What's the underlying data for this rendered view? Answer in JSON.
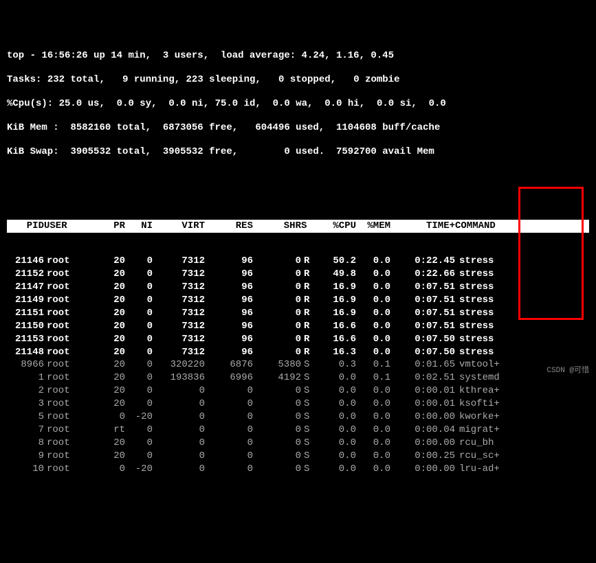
{
  "summary": {
    "line1": {
      "prog": "top",
      "time": "16:56:26",
      "up": "up 14 min,",
      "users": "3 users,",
      "la_lbl": "load average:",
      "la": "4.24, 1.16, 0.45"
    },
    "tasks": {
      "lbl": "Tasks:",
      "total": "232",
      "total_lbl": "total,",
      "running": "9",
      "running_lbl": "running,",
      "sleeping": "223",
      "sleeping_lbl": "sleeping,",
      "stopped": "0",
      "stopped_lbl": "stopped,",
      "zombie": "0",
      "zombie_lbl": "zombie"
    },
    "cpu": {
      "lbl": "%Cpu(s):",
      "us": "25.0",
      "us_lbl": "us,",
      "sy": "0.0",
      "sy_lbl": "sy,",
      "ni": "0.0",
      "ni_lbl": "ni,",
      "id": "75.0",
      "id_lbl": "id,",
      "wa": "0.0",
      "wa_lbl": "wa,",
      "hi": "0.0",
      "hi_lbl": "hi,",
      "si": "0.0",
      "si_lbl": "si,",
      "st": "0.0"
    },
    "mem": {
      "lbl": "KiB Mem :",
      "total": "8582160",
      "total_lbl": "total,",
      "free": "6873056",
      "free_lbl": "free,",
      "used": "604496",
      "used_lbl": "used,",
      "buff": "1104608",
      "buff_lbl": "buff/cache"
    },
    "swap": {
      "lbl": "KiB Swap:",
      "total": "3905532",
      "total_lbl": "total,",
      "free": "3905532",
      "free_lbl": "free,",
      "used": "0",
      "used_lbl": "used.",
      "avail": "7592700",
      "avail_lbl": "avail Mem"
    }
  },
  "columns": {
    "pid": "PID",
    "user": "USER",
    "pr": "PR",
    "ni": "NI",
    "virt": "VIRT",
    "res": "RES",
    "shr": "SHR",
    "s": "S",
    "cpu": "%CPU",
    "mem": "%MEM",
    "time": "TIME+",
    "cmd": "COMMAND"
  },
  "processes": [
    {
      "pid": "21146",
      "user": "root",
      "pr": "20",
      "ni": "0",
      "virt": "7312",
      "res": "96",
      "shr": "0",
      "s": "R",
      "cpu": "50.2",
      "mem": "0.0",
      "time": "0:22.45",
      "cmd": "stress",
      "bold": true
    },
    {
      "pid": "21152",
      "user": "root",
      "pr": "20",
      "ni": "0",
      "virt": "7312",
      "res": "96",
      "shr": "0",
      "s": "R",
      "cpu": "49.8",
      "mem": "0.0",
      "time": "0:22.66",
      "cmd": "stress",
      "bold": true
    },
    {
      "pid": "21147",
      "user": "root",
      "pr": "20",
      "ni": "0",
      "virt": "7312",
      "res": "96",
      "shr": "0",
      "s": "R",
      "cpu": "16.9",
      "mem": "0.0",
      "time": "0:07.51",
      "cmd": "stress",
      "bold": true
    },
    {
      "pid": "21149",
      "user": "root",
      "pr": "20",
      "ni": "0",
      "virt": "7312",
      "res": "96",
      "shr": "0",
      "s": "R",
      "cpu": "16.9",
      "mem": "0.0",
      "time": "0:07.51",
      "cmd": "stress",
      "bold": true
    },
    {
      "pid": "21151",
      "user": "root",
      "pr": "20",
      "ni": "0",
      "virt": "7312",
      "res": "96",
      "shr": "0",
      "s": "R",
      "cpu": "16.9",
      "mem": "0.0",
      "time": "0:07.51",
      "cmd": "stress",
      "bold": true
    },
    {
      "pid": "21150",
      "user": "root",
      "pr": "20",
      "ni": "0",
      "virt": "7312",
      "res": "96",
      "shr": "0",
      "s": "R",
      "cpu": "16.6",
      "mem": "0.0",
      "time": "0:07.51",
      "cmd": "stress",
      "bold": true
    },
    {
      "pid": "21153",
      "user": "root",
      "pr": "20",
      "ni": "0",
      "virt": "7312",
      "res": "96",
      "shr": "0",
      "s": "R",
      "cpu": "16.6",
      "mem": "0.0",
      "time": "0:07.50",
      "cmd": "stress",
      "bold": true
    },
    {
      "pid": "21148",
      "user": "root",
      "pr": "20",
      "ni": "0",
      "virt": "7312",
      "res": "96",
      "shr": "0",
      "s": "R",
      "cpu": "16.3",
      "mem": "0.0",
      "time": "0:07.50",
      "cmd": "stress",
      "bold": true
    },
    {
      "pid": "8966",
      "user": "root",
      "pr": "20",
      "ni": "0",
      "virt": "320220",
      "res": "6876",
      "shr": "5380",
      "s": "S",
      "cpu": "0.3",
      "mem": "0.1",
      "time": "0:01.65",
      "cmd": "vmtool+",
      "bold": false
    },
    {
      "pid": "1",
      "user": "root",
      "pr": "20",
      "ni": "0",
      "virt": "193836",
      "res": "6996",
      "shr": "4192",
      "s": "S",
      "cpu": "0.0",
      "mem": "0.1",
      "time": "0:02.51",
      "cmd": "systemd",
      "bold": false
    },
    {
      "pid": "2",
      "user": "root",
      "pr": "20",
      "ni": "0",
      "virt": "0",
      "res": "0",
      "shr": "0",
      "s": "S",
      "cpu": "0.0",
      "mem": "0.0",
      "time": "0:00.01",
      "cmd": "kthrea+",
      "bold": false
    },
    {
      "pid": "3",
      "user": "root",
      "pr": "20",
      "ni": "0",
      "virt": "0",
      "res": "0",
      "shr": "0",
      "s": "S",
      "cpu": "0.0",
      "mem": "0.0",
      "time": "0:00.01",
      "cmd": "ksofti+",
      "bold": false
    },
    {
      "pid": "5",
      "user": "root",
      "pr": "0",
      "ni": "-20",
      "virt": "0",
      "res": "0",
      "shr": "0",
      "s": "S",
      "cpu": "0.0",
      "mem": "0.0",
      "time": "0:00.00",
      "cmd": "kworke+",
      "bold": false
    },
    {
      "pid": "7",
      "user": "root",
      "pr": "rt",
      "ni": "0",
      "virt": "0",
      "res": "0",
      "shr": "0",
      "s": "S",
      "cpu": "0.0",
      "mem": "0.0",
      "time": "0:00.04",
      "cmd": "migrat+",
      "bold": false
    },
    {
      "pid": "8",
      "user": "root",
      "pr": "20",
      "ni": "0",
      "virt": "0",
      "res": "0",
      "shr": "0",
      "s": "S",
      "cpu": "0.0",
      "mem": "0.0",
      "time": "0:00.00",
      "cmd": "rcu_bh",
      "bold": false
    },
    {
      "pid": "9",
      "user": "root",
      "pr": "20",
      "ni": "0",
      "virt": "0",
      "res": "0",
      "shr": "0",
      "s": "S",
      "cpu": "0.0",
      "mem": "0.0",
      "time": "0:00.25",
      "cmd": "rcu_sc+",
      "bold": false
    },
    {
      "pid": "10",
      "user": "root",
      "pr": "0",
      "ni": "-20",
      "virt": "0",
      "res": "0",
      "shr": "0",
      "s": "S",
      "cpu": "0.0",
      "mem": "0.0",
      "time": "0:00.00",
      "cmd": "lru-ad+",
      "bold": false
    }
  ],
  "watermark": "CSDN @可惜"
}
